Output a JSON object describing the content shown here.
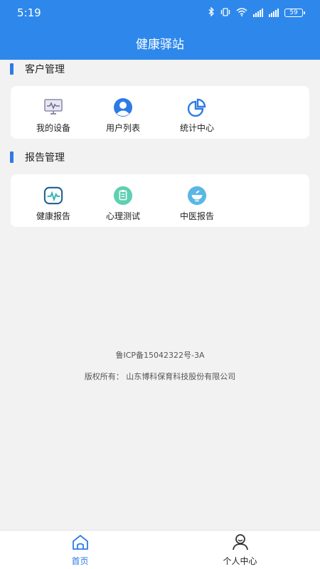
{
  "status_bar": {
    "time": "5:19",
    "icons": [
      "bluetooth-icon",
      "vibrate-icon",
      "wifi-icon",
      "signal-icon",
      "signal-icon"
    ],
    "battery": "59"
  },
  "header": {
    "title": "健康驿站"
  },
  "sections": [
    {
      "title": "客户管理",
      "items": [
        {
          "label": "我的设备",
          "icon": "monitor-icon"
        },
        {
          "label": "用户列表",
          "icon": "user-icon"
        },
        {
          "label": "统计中心",
          "icon": "pie-chart-icon"
        }
      ]
    },
    {
      "title": "报告管理",
      "items": [
        {
          "label": "健康报告",
          "icon": "heartbeat-icon"
        },
        {
          "label": "心理测试",
          "icon": "clipboard-icon"
        },
        {
          "label": "中医报告",
          "icon": "herbal-bowl-icon"
        }
      ]
    }
  ],
  "footer": {
    "icp": "鲁ICP备15042322号-3A",
    "copyright": "版权所有：  山东博科保育科技股份有限公司"
  },
  "tabbar": {
    "tabs": [
      {
        "label": "首页",
        "icon": "home-icon",
        "active": true
      },
      {
        "label": "个人中心",
        "icon": "person-icon",
        "active": false
      }
    ]
  },
  "colors": {
    "primary": "#2e88ec",
    "section_marker": "#2e7be6",
    "background": "#f2f2f2",
    "active_tab": "#2e7be6"
  }
}
